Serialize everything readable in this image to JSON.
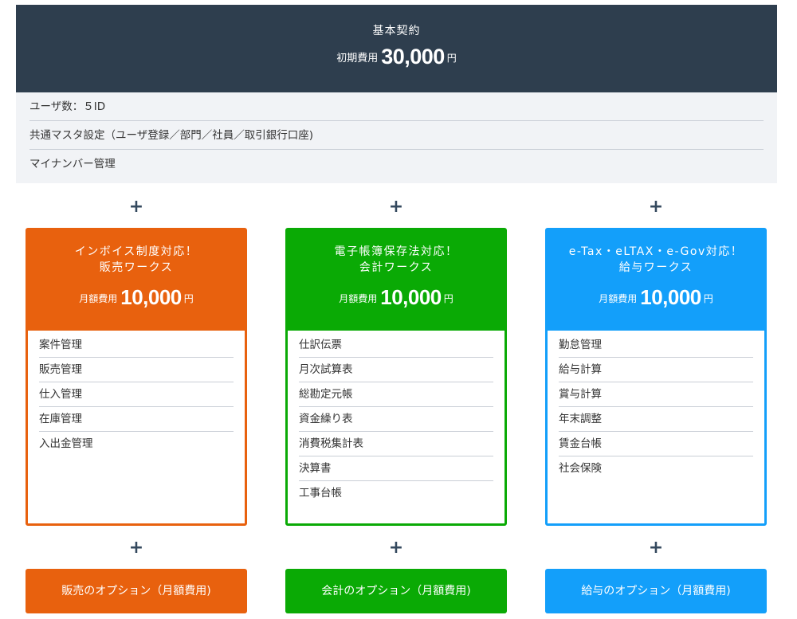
{
  "colors": {
    "header": "#2e3e4e",
    "features_bg": "#f1f3f6",
    "sales": "#e8610e",
    "accounting": "#0aaa05",
    "payroll": "#139ffa"
  },
  "base": {
    "title": "基本契約",
    "price_label": "初期費用",
    "price_value": "30,000",
    "price_unit": "円",
    "features": [
      "ユーザ数：５ID",
      "共通マスタ設定（ユーザ登録／部門／社員／取引銀行口座)",
      "マイナンバー管理"
    ]
  },
  "plus_symbol": "+",
  "cards": [
    {
      "title_line1": "インボイス制度対応！",
      "title_line2": "販売ワークス",
      "price_label": "月額費用",
      "price_value": "10,000",
      "price_unit": "円",
      "items": [
        "案件管理",
        "販売管理",
        "仕入管理",
        "在庫管理",
        "入出金管理"
      ],
      "option_label": "販売のオプション（月額費用)"
    },
    {
      "title_line1": "電子帳簿保存法対応！",
      "title_line2": "会計ワークス",
      "price_label": "月額費用",
      "price_value": "10,000",
      "price_unit": "円",
      "items": [
        "仕訳伝票",
        "月次試算表",
        "総勘定元帳",
        "資金繰り表",
        "消費税集計表",
        "決算書",
        "工事台帳"
      ],
      "option_label": "会計のオプション（月額費用)"
    },
    {
      "title_line1": "e-Tax・eLTAX・e-Gov対応！",
      "title_line2": "給与ワークス",
      "price_label": "月額費用",
      "price_value": "10,000",
      "price_unit": "円",
      "items": [
        "勤怠管理",
        "給与計算",
        "賞与計算",
        "年末調整",
        "賃金台帳",
        "社会保険"
      ],
      "option_label": "給与のオプション（月額費用)"
    }
  ]
}
